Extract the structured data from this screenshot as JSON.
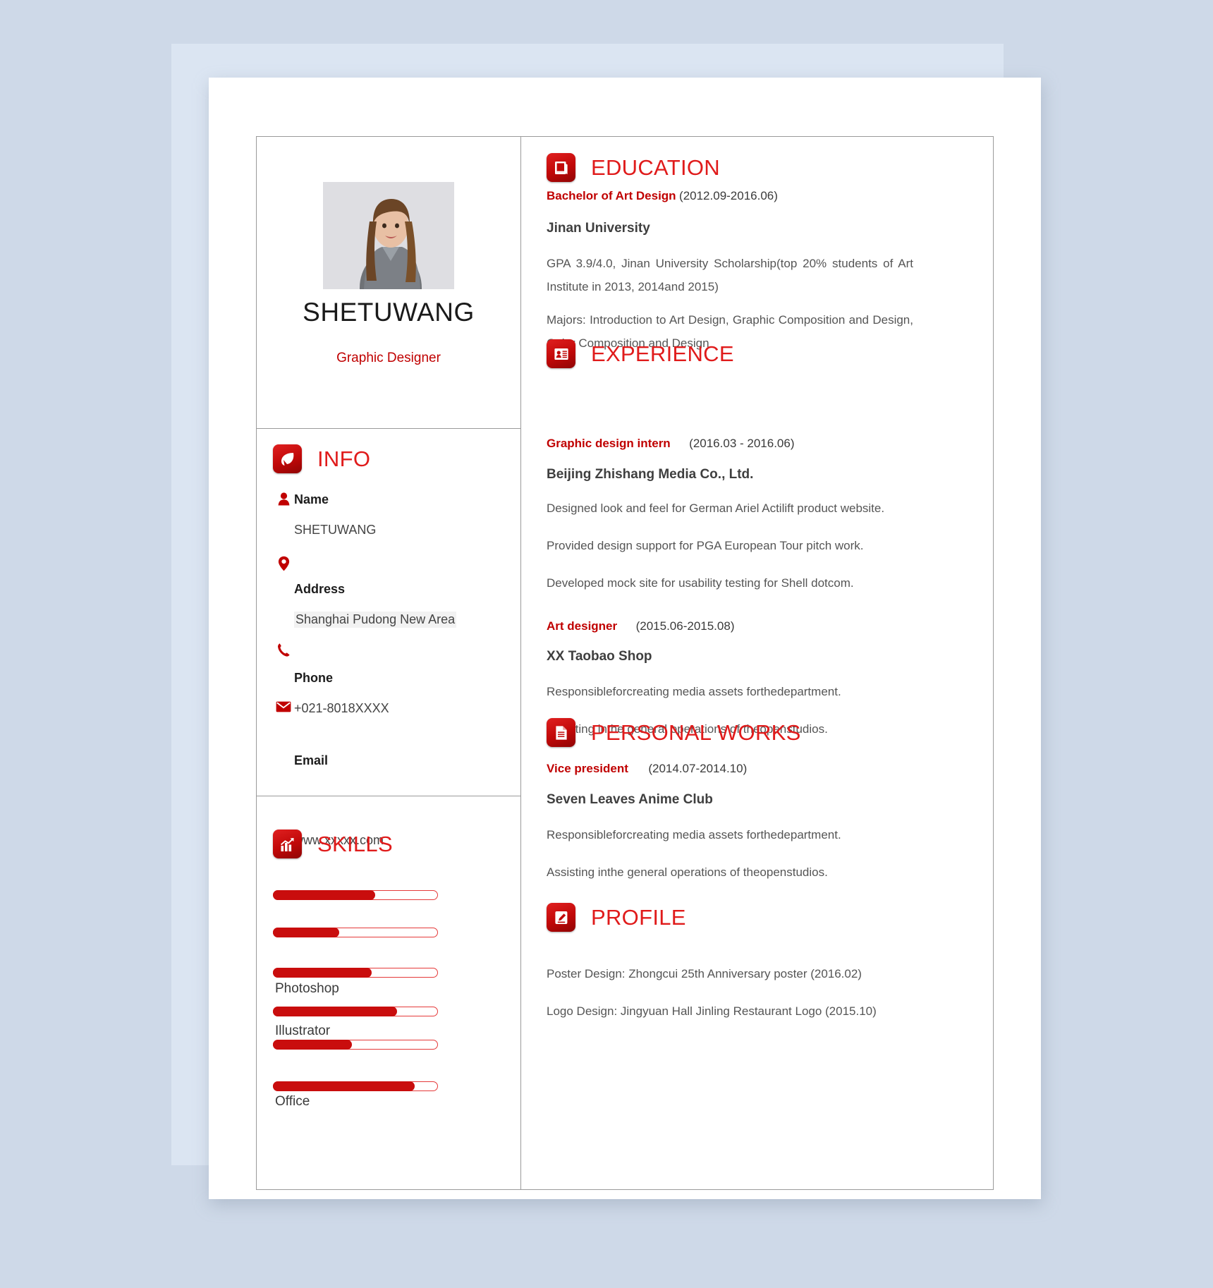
{
  "header": {
    "name": "SHETUWANG",
    "role": "Graphic Designer"
  },
  "sections": {
    "info_title": "INFO",
    "skills_title": "SKILLS",
    "education_title": "EDUCATION",
    "experience_title": "EXPERIENCE",
    "personal_works_title": "PERSONAL WORKS",
    "profile_title": "PROFILE"
  },
  "info": {
    "name_label": "Name",
    "name_value": "SHETUWANG",
    "address_label": "Address",
    "address_value": "Shanghai Pudong New Area",
    "phone_label": "Phone",
    "phone_value": "+021-8018XXXX",
    "email_label": "Email",
    "email_value": "www.xxxxx.com"
  },
  "skills": [
    {
      "label": "",
      "percent": 62
    },
    {
      "label": "",
      "percent": 40
    },
    {
      "label": "Photoshop",
      "percent": 60
    },
    {
      "label": "Illustrator",
      "percent": 75
    },
    {
      "label": "",
      "percent": 48
    },
    {
      "label": "Office",
      "percent": 86
    }
  ],
  "education": {
    "degree": "Bachelor of Art Design",
    "date": "(2012.09-2016.06)",
    "school": "Jinan University",
    "detail": "GPA 3.9/4.0, Jinan University Scholarship(top 20% students of Art Institute in 2013, 2014and 2015)",
    "majors": "Majors: Introduction to Art Design, Graphic Composition and Design, Color Composition and Design"
  },
  "experience": [
    {
      "title": "Graphic design intern",
      "date": "(2016.03 - 2016.06)",
      "org": "Beijing Zhishang Media Co., Ltd.",
      "bullets": [
        "Designed look and feel for German Ariel Actilift product website.",
        "Provided design support for PGA European Tour pitch work.",
        "Developed mock site for usability testing for Shell dotcom."
      ]
    },
    {
      "title": "Art designer",
      "date": "(2015.06-2015.08)",
      "org": "XX Taobao Shop",
      "bullets": [
        "Responsibleforcreating media assets forthedepartment.",
        "Assisting inthe general operations of theopenstudios."
      ]
    }
  ],
  "personal_works": [
    {
      "title": "Vice president",
      "date": "(2014.07-2014.10)",
      "org": "Seven Leaves Anime Club",
      "bullets": [
        "Responsibleforcreating media assets forthedepartment.",
        "Assisting inthe general operations of theopenstudios."
      ]
    }
  ],
  "profile": {
    "lines": [
      "Poster Design: Zhongcui 25th Anniversary poster (2016.02)",
      "Logo Design: Jingyuan Hall Jinling Restaurant Logo (2015.10)"
    ]
  },
  "colors": {
    "accent": "#c00000",
    "heading": "#e01b1b",
    "page": "#ced9e8"
  }
}
